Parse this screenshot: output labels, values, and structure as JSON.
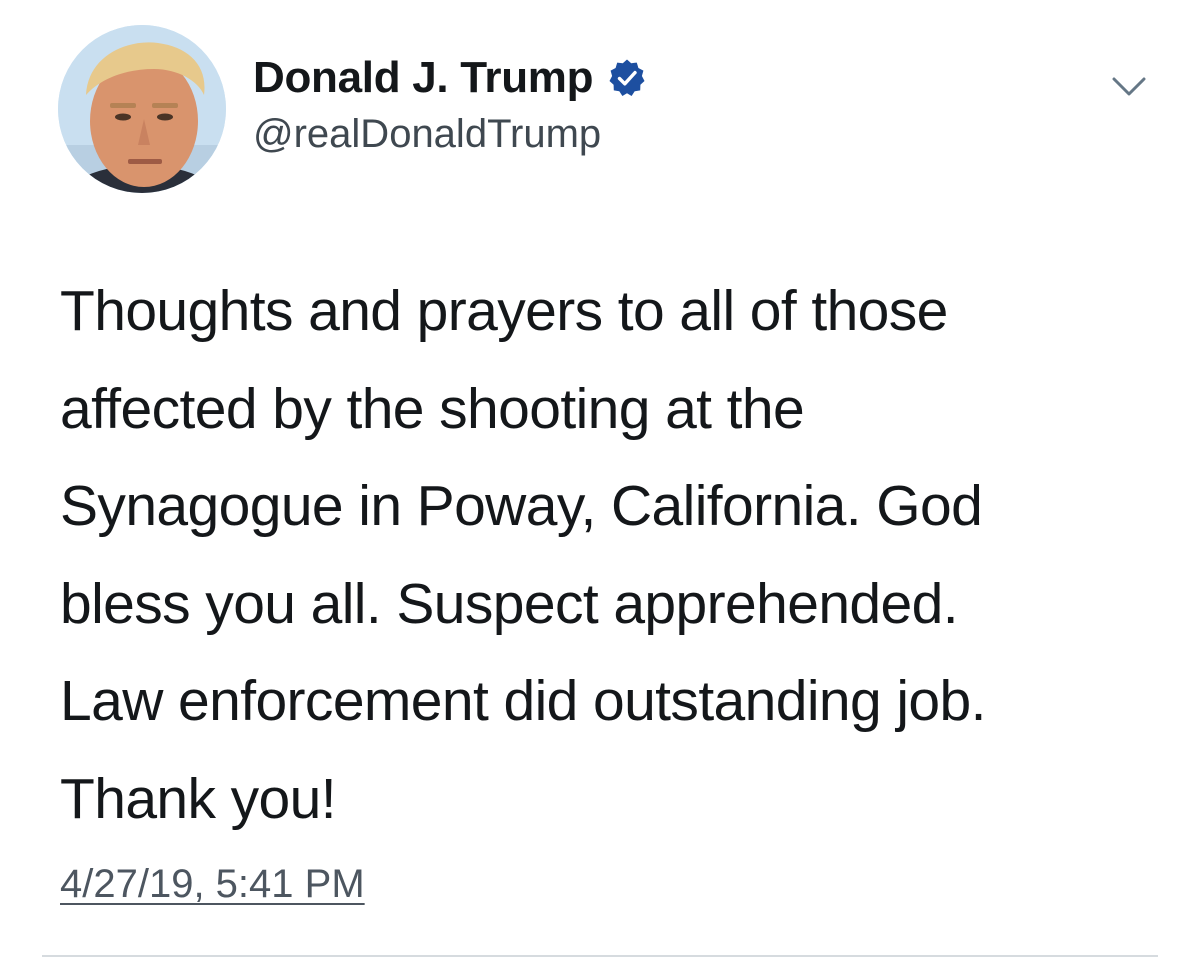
{
  "tweet": {
    "display_name": "Donald J. Trump",
    "handle": "@realDonaldTrump",
    "verified": true,
    "text": "Thoughts and prayers to all of those\naffected by the shooting at the\nSynagogue in Poway, California. God\nbless you all. Suspect apprehended.\nLaw enforcement did outstanding job.\nThank you!",
    "timestamp": "4/27/19, 5:41 PM"
  },
  "icons": {
    "verified": "verified-badge-icon",
    "menu": "chevron-down-icon"
  },
  "colors": {
    "verified_badge": "#1d4fa0",
    "text": "#14171a",
    "secondary_text": "#657786",
    "divider": "#d6dbdf"
  }
}
